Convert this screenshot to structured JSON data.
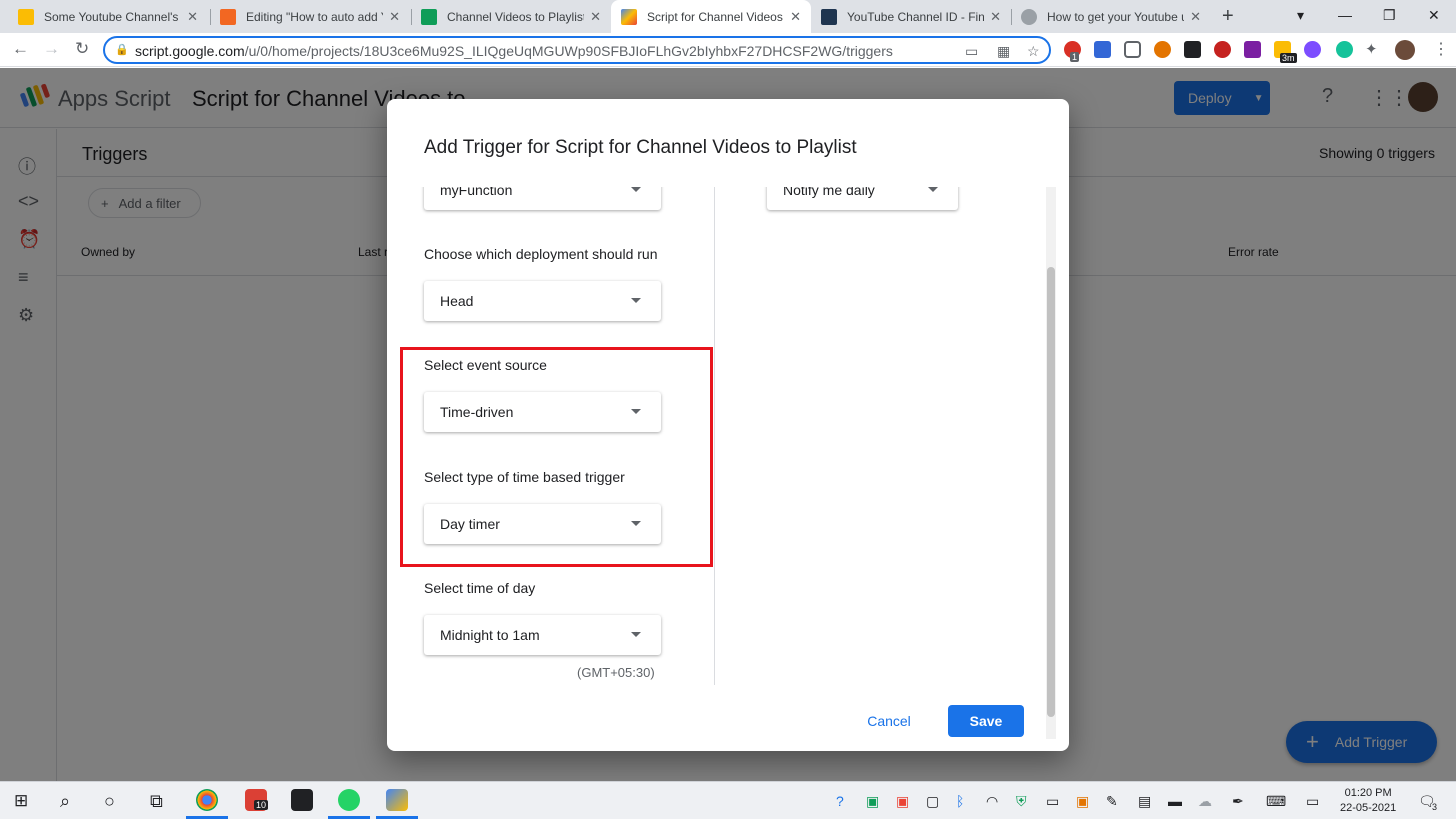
{
  "browser": {
    "tabs": [
      {
        "title": "Some Youtube Channel's Vi",
        "color": "#fbbc04"
      },
      {
        "title": "Editing \"How to auto add Yo",
        "color": "#f26722"
      },
      {
        "title": "Channel Videos to Playlist -",
        "color": "#0f9d58"
      },
      {
        "title": "Script for Channel Videos to",
        "color": "#4285f4"
      },
      {
        "title": "YouTube Channel ID - Find",
        "color": "#1f3550"
      },
      {
        "title": "How to get your Youtube us",
        "color": "#5f6368"
      }
    ],
    "url_host": "script.google.com",
    "url_path": "/u/0/home/projects/18U3ce6Mu92S_ILIQgeUqMGUWp90SFBJIoFLhGv2bIyhbxF27DHCSF2WG/triggers",
    "extension_badge_count": "1",
    "extension_badge_time": "3m"
  },
  "apps_script": {
    "product_name": "Apps Script",
    "project_title": "Script for Channel Videos to",
    "deploy_label": "Deploy",
    "page_title": "Triggers",
    "showing_text": "Showing 0 triggers",
    "add_filter_label": "Add a filter",
    "columns": [
      "Owned by",
      "Last r",
      "Error rate"
    ],
    "add_trigger_label": "Add Trigger"
  },
  "dialog": {
    "title": "Add Trigger for Script for Channel Videos to Playlist",
    "function_value": "myFunction",
    "deployment_label": "Choose which deployment should run",
    "deployment_value": "Head",
    "event_source_label": "Select event source",
    "event_source_value": "Time-driven",
    "time_trigger_type_label": "Select type of time based trigger",
    "time_trigger_type_value": "Day timer",
    "time_of_day_label": "Select time of day",
    "time_of_day_value": "Midnight to 1am",
    "timezone_note": "(GMT+05:30)",
    "failure_notification_value": "Notify me daily",
    "cancel_label": "Cancel",
    "save_label": "Save",
    "highlight_color": "#e8141c"
  },
  "taskbar": {
    "time": "01:20 PM",
    "date": "22-05-2021",
    "todoist_badge": "10",
    "notification_count": "3"
  }
}
